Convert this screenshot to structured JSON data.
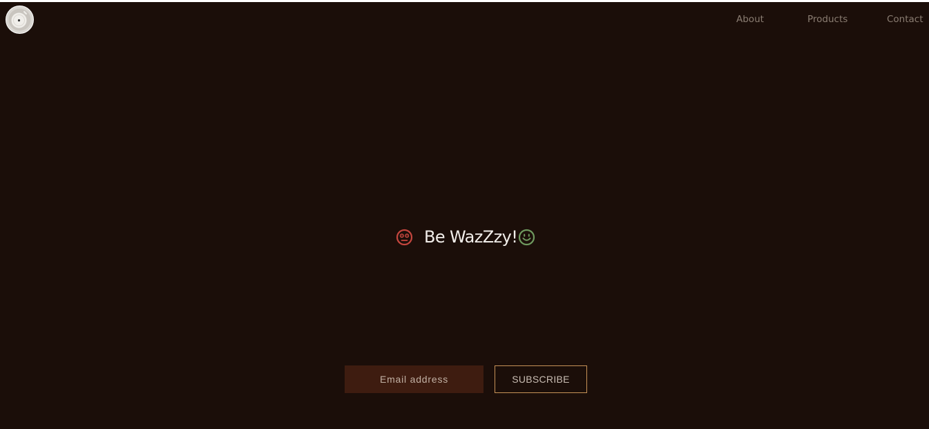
{
  "nav": {
    "logo_icon": "vinyl-record-icon",
    "items": [
      {
        "label": "About"
      },
      {
        "label": "Products"
      },
      {
        "label": "Contact"
      }
    ]
  },
  "hero": {
    "title": "Be WazZzy!",
    "left_icon": "dizzy-face-icon",
    "right_icon": "smiley-face-icon"
  },
  "subscribe": {
    "email_placeholder": "Email address",
    "email_value": "",
    "button_label": "SUBSCRIBE"
  },
  "colors": {
    "background": "#1b0e09",
    "nav_text": "#8a7d72",
    "title_text": "#f2eeea",
    "sad_face": "#c5463e",
    "happy_face": "#6f9a5f",
    "input_bg": "#3e1c10",
    "button_border": "#c89358"
  }
}
